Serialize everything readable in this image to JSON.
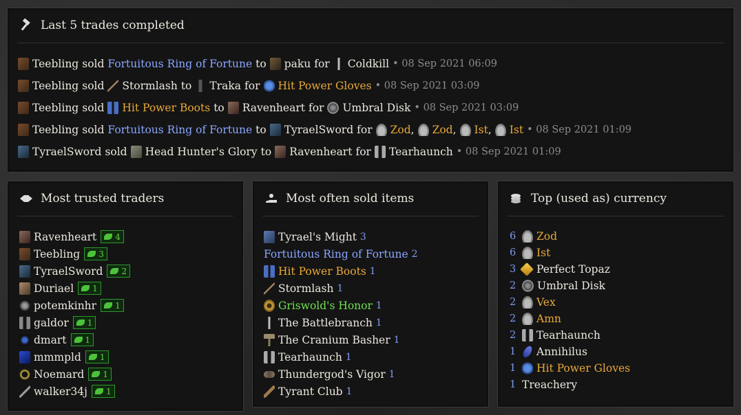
{
  "last_trades": {
    "title": "Last 5 trades completed",
    "rows": [
      {
        "seller": "Teebling",
        "sold_word": "sold",
        "item": "Fortuitous Ring of Fortune",
        "to_word": "to",
        "buyer": "paku",
        "for_word": "for",
        "payment": [
          {
            "name": "Coldkill",
            "sep": ""
          }
        ],
        "time": "• 08 Sep 2021 06:09"
      },
      {
        "seller": "Teebling",
        "sold_word": "sold",
        "item": "Stormlash",
        "to_word": "to",
        "buyer": "Traka",
        "for_word": "for",
        "payment": [
          {
            "name": "Hit Power Gloves",
            "sep": ""
          }
        ],
        "time": "• 08 Sep 2021 03:09"
      },
      {
        "seller": "Teebling",
        "sold_word": "sold",
        "item": "Hit Power Boots",
        "to_word": "to",
        "buyer": "Ravenheart",
        "for_word": "for",
        "payment": [
          {
            "name": "Umbral Disk",
            "sep": ""
          }
        ],
        "time": "• 08 Sep 2021 03:09"
      },
      {
        "seller": "Teebling",
        "sold_word": "sold",
        "item": "Fortuitous Ring of Fortune",
        "to_word": "to",
        "buyer": "TyraelSword",
        "for_word": "for",
        "payment": [
          {
            "name": "Zod",
            "sep": ","
          },
          {
            "name": "Zod",
            "sep": ","
          },
          {
            "name": "Ist",
            "sep": ","
          },
          {
            "name": "Ist",
            "sep": ""
          }
        ],
        "time": "• 08 Sep 2021 01:09"
      },
      {
        "seller": "TyraelSword",
        "sold_word": "sold",
        "item": "Head Hunter's Glory",
        "to_word": "to",
        "buyer": "Ravenheart",
        "for_word": "for",
        "payment": [
          {
            "name": "Tearhaunch",
            "sep": ""
          }
        ],
        "time": "• 08 Sep 2021 01:09"
      }
    ]
  },
  "trusted": {
    "title": "Most trusted traders",
    "rows": [
      {
        "name": "Ravenheart",
        "count": "4"
      },
      {
        "name": "Teebling",
        "count": "3"
      },
      {
        "name": "TyraelSword",
        "count": "2"
      },
      {
        "name": "Duriael",
        "count": "1"
      },
      {
        "name": "potemkinhr",
        "count": "1"
      },
      {
        "name": "galdor",
        "count": "1"
      },
      {
        "name": "dmart",
        "count": "1"
      },
      {
        "name": "mmmpld",
        "count": "1"
      },
      {
        "name": "Noemard",
        "count": "1"
      },
      {
        "name": "walker34j",
        "count": "1"
      }
    ]
  },
  "sold_items": {
    "title": "Most often sold items",
    "rows": [
      {
        "name": "Tyrael's Might",
        "count": "3"
      },
      {
        "name": "Fortuitous Ring of Fortune",
        "count": "2"
      },
      {
        "name": "Hit Power Boots",
        "count": "1"
      },
      {
        "name": "Stormlash",
        "count": "1"
      },
      {
        "name": "Griswold's Honor",
        "count": "1"
      },
      {
        "name": "The Battlebranch",
        "count": "1"
      },
      {
        "name": "The Cranium Basher",
        "count": "1"
      },
      {
        "name": "Tearhaunch",
        "count": "1"
      },
      {
        "name": "Thundergod's Vigor",
        "count": "1"
      },
      {
        "name": "Tyrant Club",
        "count": "1"
      }
    ]
  },
  "currency": {
    "title": "Top (used as) currency",
    "rows": [
      {
        "count": "6",
        "name": "Zod"
      },
      {
        "count": "6",
        "name": "Ist"
      },
      {
        "count": "3",
        "name": "Perfect Topaz"
      },
      {
        "count": "2",
        "name": "Umbral Disk"
      },
      {
        "count": "2",
        "name": "Vex"
      },
      {
        "count": "2",
        "name": "Amn"
      },
      {
        "count": "2",
        "name": "Tearhaunch"
      },
      {
        "count": "1",
        "name": "Annihilus"
      },
      {
        "count": "1",
        "name": "Hit Power Gloves"
      },
      {
        "count": "1",
        "name": "Treachery"
      }
    ]
  },
  "colors": {
    "magic": "#8aa6ff",
    "rare": "#e9a93a",
    "set": "#6fe14e",
    "plain": "#ece8df",
    "muted": "#8b8b8b"
  }
}
